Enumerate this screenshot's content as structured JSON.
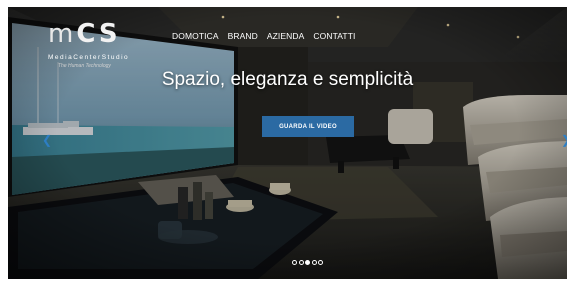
{
  "brand": {
    "logo_mark": "MCS",
    "name": "MediaCenterStudio",
    "tagline": "The Human Technology"
  },
  "nav": {
    "items": [
      {
        "label": "DOMOTICA"
      },
      {
        "label": "BRAND"
      },
      {
        "label": "AZIENDA"
      },
      {
        "label": "CONTATTI"
      }
    ]
  },
  "hero": {
    "headline": "Spazio, eleganza e semplicità",
    "cta_label": "GUARDA IL VIDEO",
    "slides_total": 5,
    "active_slide": 3
  },
  "colors": {
    "cta": "#2b6aa3",
    "arrow": "#2d7ec4"
  },
  "icons": {
    "prev": "chevron-left-icon",
    "next": "chevron-right-icon"
  }
}
